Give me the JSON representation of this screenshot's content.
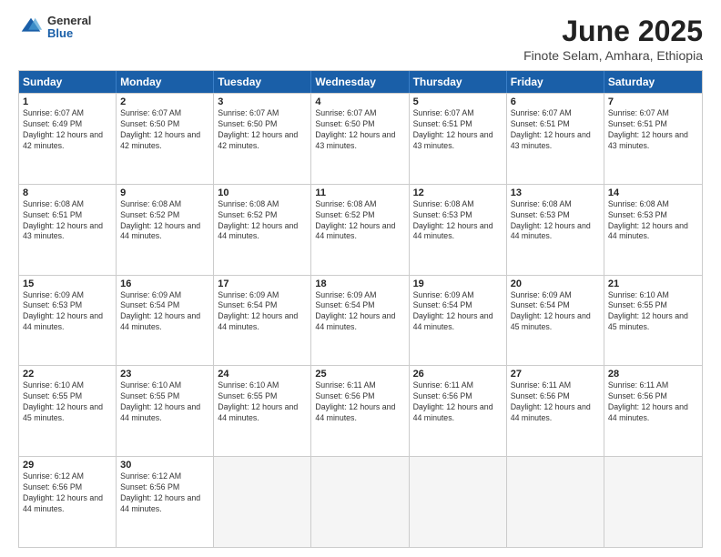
{
  "header": {
    "logo_general": "General",
    "logo_blue": "Blue",
    "title": "June 2025",
    "subtitle": "Finote Selam, Amhara, Ethiopia"
  },
  "calendar": {
    "days_of_week": [
      "Sunday",
      "Monday",
      "Tuesday",
      "Wednesday",
      "Thursday",
      "Friday",
      "Saturday"
    ],
    "weeks": [
      [
        {
          "day": null,
          "empty": true
        },
        {
          "day": null,
          "empty": true
        },
        {
          "day": null,
          "empty": true
        },
        {
          "day": null,
          "empty": true
        },
        {
          "day": null,
          "empty": true
        },
        {
          "day": null,
          "empty": true
        },
        {
          "day": null,
          "empty": true
        }
      ],
      [
        {
          "day": 1,
          "sunrise": "6:07 AM",
          "sunset": "6:49 PM",
          "daylight": "12 hours and 42 minutes."
        },
        {
          "day": 2,
          "sunrise": "6:07 AM",
          "sunset": "6:50 PM",
          "daylight": "12 hours and 42 minutes."
        },
        {
          "day": 3,
          "sunrise": "6:07 AM",
          "sunset": "6:50 PM",
          "daylight": "12 hours and 42 minutes."
        },
        {
          "day": 4,
          "sunrise": "6:07 AM",
          "sunset": "6:50 PM",
          "daylight": "12 hours and 43 minutes."
        },
        {
          "day": 5,
          "sunrise": "6:07 AM",
          "sunset": "6:51 PM",
          "daylight": "12 hours and 43 minutes."
        },
        {
          "day": 6,
          "sunrise": "6:07 AM",
          "sunset": "6:51 PM",
          "daylight": "12 hours and 43 minutes."
        },
        {
          "day": 7,
          "sunrise": "6:07 AM",
          "sunset": "6:51 PM",
          "daylight": "12 hours and 43 minutes."
        }
      ],
      [
        {
          "day": 8,
          "sunrise": "6:08 AM",
          "sunset": "6:51 PM",
          "daylight": "12 hours and 43 minutes."
        },
        {
          "day": 9,
          "sunrise": "6:08 AM",
          "sunset": "6:52 PM",
          "daylight": "12 hours and 44 minutes."
        },
        {
          "day": 10,
          "sunrise": "6:08 AM",
          "sunset": "6:52 PM",
          "daylight": "12 hours and 44 minutes."
        },
        {
          "day": 11,
          "sunrise": "6:08 AM",
          "sunset": "6:52 PM",
          "daylight": "12 hours and 44 minutes."
        },
        {
          "day": 12,
          "sunrise": "6:08 AM",
          "sunset": "6:53 PM",
          "daylight": "12 hours and 44 minutes."
        },
        {
          "day": 13,
          "sunrise": "6:08 AM",
          "sunset": "6:53 PM",
          "daylight": "12 hours and 44 minutes."
        },
        {
          "day": 14,
          "sunrise": "6:08 AM",
          "sunset": "6:53 PM",
          "daylight": "12 hours and 44 minutes."
        }
      ],
      [
        {
          "day": 15,
          "sunrise": "6:09 AM",
          "sunset": "6:53 PM",
          "daylight": "12 hours and 44 minutes."
        },
        {
          "day": 16,
          "sunrise": "6:09 AM",
          "sunset": "6:54 PM",
          "daylight": "12 hours and 44 minutes."
        },
        {
          "day": 17,
          "sunrise": "6:09 AM",
          "sunset": "6:54 PM",
          "daylight": "12 hours and 44 minutes."
        },
        {
          "day": 18,
          "sunrise": "6:09 AM",
          "sunset": "6:54 PM",
          "daylight": "12 hours and 44 minutes."
        },
        {
          "day": 19,
          "sunrise": "6:09 AM",
          "sunset": "6:54 PM",
          "daylight": "12 hours and 44 minutes."
        },
        {
          "day": 20,
          "sunrise": "6:09 AM",
          "sunset": "6:54 PM",
          "daylight": "12 hours and 45 minutes."
        },
        {
          "day": 21,
          "sunrise": "6:10 AM",
          "sunset": "6:55 PM",
          "daylight": "12 hours and 45 minutes."
        }
      ],
      [
        {
          "day": 22,
          "sunrise": "6:10 AM",
          "sunset": "6:55 PM",
          "daylight": "12 hours and 45 minutes."
        },
        {
          "day": 23,
          "sunrise": "6:10 AM",
          "sunset": "6:55 PM",
          "daylight": "12 hours and 44 minutes."
        },
        {
          "day": 24,
          "sunrise": "6:10 AM",
          "sunset": "6:55 PM",
          "daylight": "12 hours and 44 minutes."
        },
        {
          "day": 25,
          "sunrise": "6:11 AM",
          "sunset": "6:56 PM",
          "daylight": "12 hours and 44 minutes."
        },
        {
          "day": 26,
          "sunrise": "6:11 AM",
          "sunset": "6:56 PM",
          "daylight": "12 hours and 44 minutes."
        },
        {
          "day": 27,
          "sunrise": "6:11 AM",
          "sunset": "6:56 PM",
          "daylight": "12 hours and 44 minutes."
        },
        {
          "day": 28,
          "sunrise": "6:11 AM",
          "sunset": "6:56 PM",
          "daylight": "12 hours and 44 minutes."
        }
      ],
      [
        {
          "day": 29,
          "sunrise": "6:12 AM",
          "sunset": "6:56 PM",
          "daylight": "12 hours and 44 minutes."
        },
        {
          "day": 30,
          "sunrise": "6:12 AM",
          "sunset": "6:56 PM",
          "daylight": "12 hours and 44 minutes."
        },
        {
          "day": null,
          "empty": true
        },
        {
          "day": null,
          "empty": true
        },
        {
          "day": null,
          "empty": true
        },
        {
          "day": null,
          "empty": true
        },
        {
          "day": null,
          "empty": true
        }
      ]
    ]
  }
}
